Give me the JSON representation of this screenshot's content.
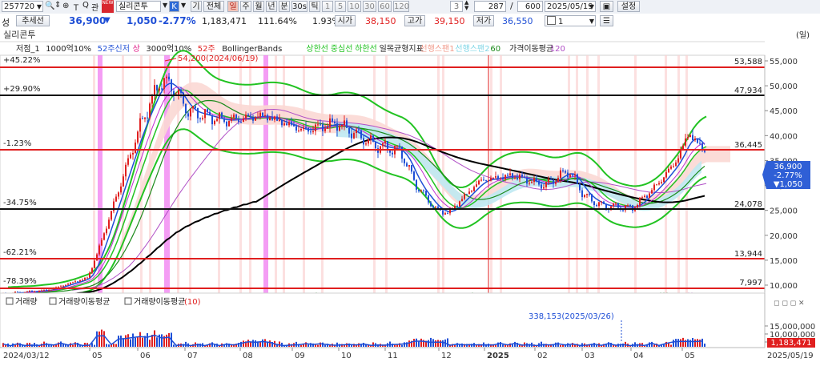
{
  "toolbar": {
    "code": "257720",
    "code_btn": "관",
    "news_badge": "NEW",
    "stock_name": "실리콘투",
    "k_btn": "K",
    "gi_btn": "기",
    "all_btn": "전체",
    "period_tabs": [
      "일",
      "주",
      "월",
      "년",
      "분",
      "30s",
      "틱",
      "1",
      "5",
      "10",
      "30",
      "60",
      "120"
    ],
    "active_period": "일",
    "spin_value": "3",
    "count_current": "287",
    "count_sep": "/",
    "count_total": "600",
    "date": "2025/05/19",
    "setting_btn": "설정",
    "num_select": "1"
  },
  "quote": {
    "left_label": "성",
    "tab_name": "추세선",
    "price": "36,900",
    "arrow": "▼",
    "change": "1,050",
    "change_pct": "-2.77%",
    "volume": "1,183,471",
    "vol_ratio": "111.64%",
    "turnover": "1.93%",
    "open_label": "시가",
    "open": "38,150",
    "high_label": "고가",
    "high": "39,150",
    "low_label": "저가",
    "low": "36,550"
  },
  "chart": {
    "title": "실리콘투",
    "unit": "(일)",
    "legend": [
      {
        "text": "저점_1",
        "color": "#222222"
      },
      {
        "text": "1000억10%",
        "color": "#222222"
      },
      {
        "text": "52주신저",
        "color": "#1f4fd6"
      },
      {
        "text": "상",
        "color": "#e0218a"
      },
      {
        "text": "3000억10%",
        "color": "#222222"
      },
      {
        "text": "52주",
        "color": "#e01f1f"
      },
      {
        "text": "BollingerBands",
        "color": "#222222"
      },
      {
        "text": "상한선",
        "color": "#22c322"
      },
      {
        "text": "중심선",
        "color": "#22c322"
      },
      {
        "text": "하한선",
        "color": "#22c322"
      },
      {
        "text": "일목균형지표",
        "color": "#222222"
      },
      {
        "text": "선행스팬1",
        "color": "#f19a8a"
      },
      {
        "text": "선행스팬2",
        "color": "#7fd6e6"
      },
      {
        "text": "60",
        "color": "#1a8a1a"
      },
      {
        "text": "가격이동평균",
        "color": "#222222"
      },
      {
        "text": "120",
        "color": "#b04fc6"
      }
    ],
    "percent_labels": [
      "+45.22%",
      "+29.90%",
      "-1.23%",
      "-34.75%",
      "-62.21%",
      "-78.39%"
    ],
    "level_labels": [
      "53,588",
      "47,934",
      "36,445",
      "24,078",
      "13,944",
      "7,997"
    ],
    "y_ticks": [
      "55,000",
      "50,000",
      "45,000",
      "40,000",
      "35,000",
      "30,000",
      "25,000",
      "20,000",
      "15,000",
      "10,000"
    ],
    "price_tag": [
      "36,900",
      "-2.77%",
      "▼1,050"
    ],
    "high_annotation": "54,200(2024/06/19)",
    "colors": {
      "up": "#e01f1f",
      "down": "#1f4fd6",
      "bollinger": "#22c322",
      "level_red": "#e01f1f",
      "level_black": "#111111",
      "ma60": "#1a8a1a",
      "ma120": "#b04fc6",
      "ma_long": "#000000",
      "vertical_marker": "#f07cf0"
    }
  },
  "volume_panel": {
    "legend": [
      "거래량",
      "거래량이동평균",
      "거래량이동평균"
    ],
    "legend_tail": "(10)",
    "annotation": "338,153(2025/03/26)",
    "y_ticks": [
      "15,000,000",
      "10,000,000",
      "5,000,000"
    ],
    "last_tag": "1,183,471"
  },
  "x_axis": {
    "start": "2024/03/12",
    "months": [
      "05",
      "06",
      "07",
      "08",
      "09",
      "10",
      "11",
      "12",
      "2025",
      "02",
      "03",
      "04",
      "05"
    ],
    "end": "2025/05/19"
  }
}
